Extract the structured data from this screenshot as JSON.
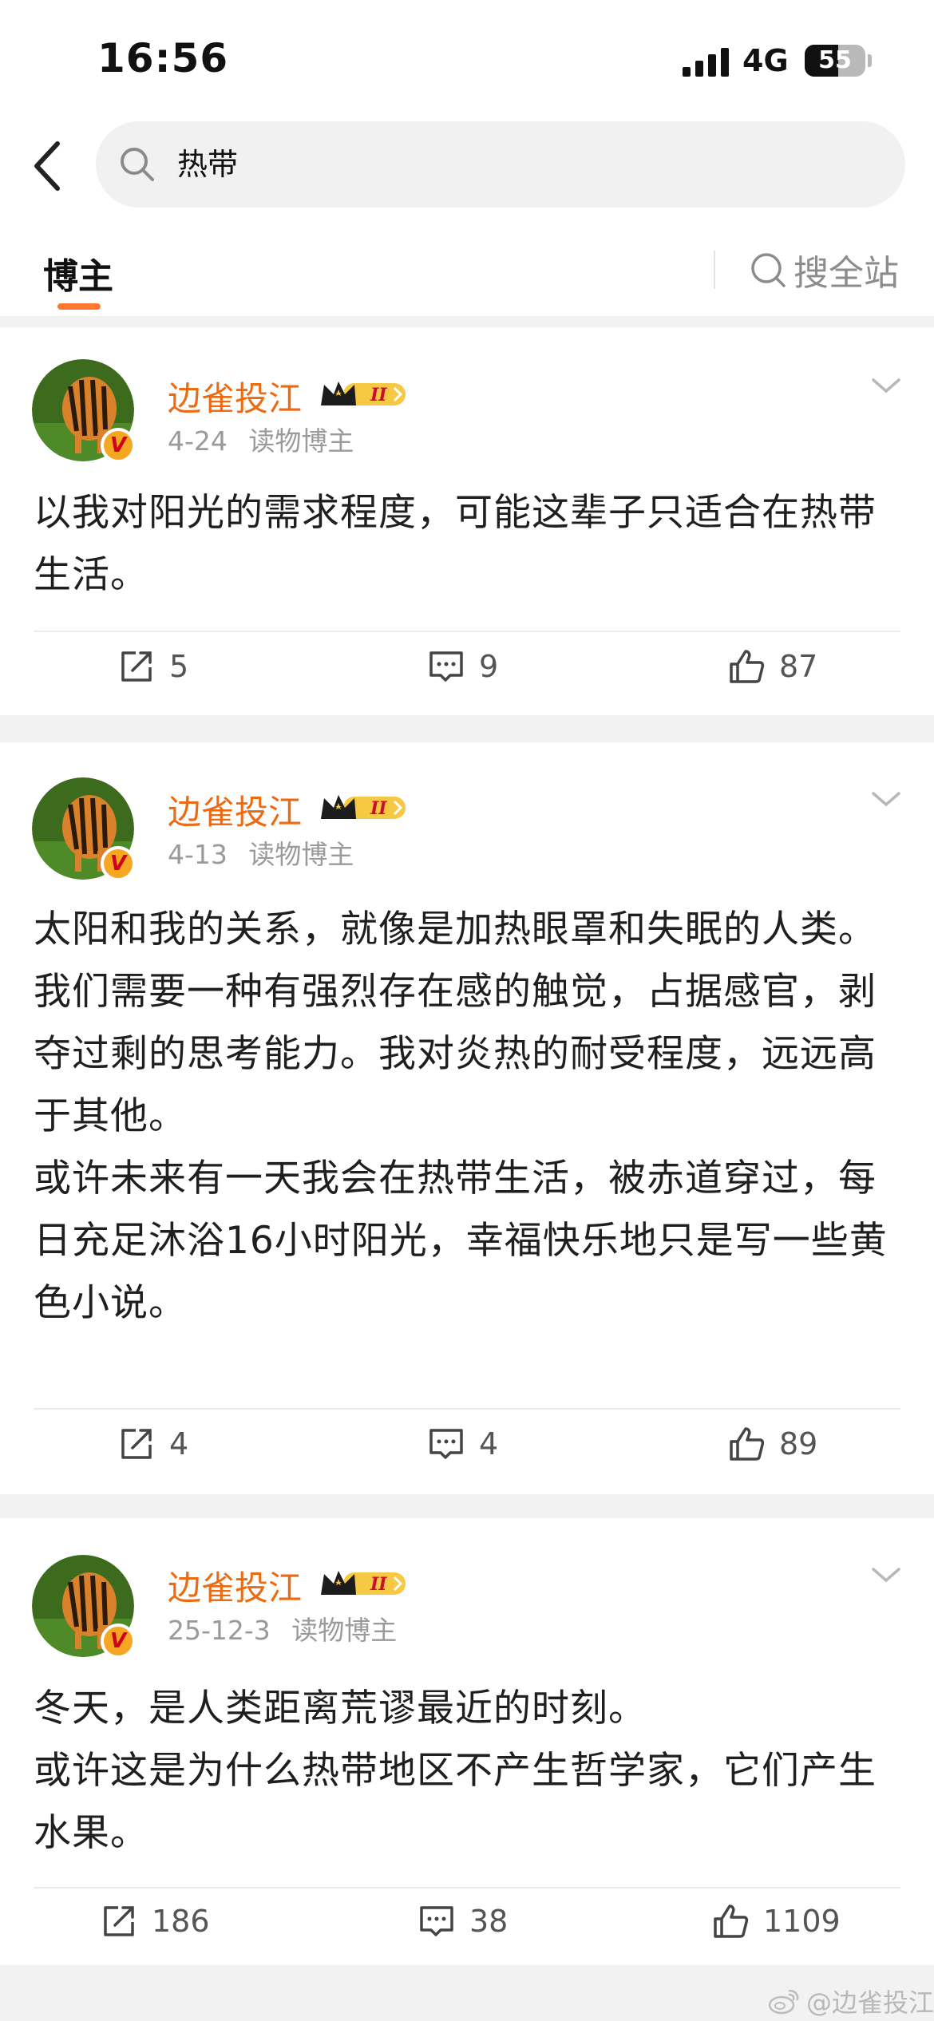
{
  "status_bar": {
    "time": "16:56",
    "network": "4G",
    "battery": "55",
    "battery_level": 0.55
  },
  "search": {
    "query": "热带"
  },
  "tabs": {
    "active": "博主",
    "search_all": "搜全站"
  },
  "posts": [
    {
      "author": "边雀投江",
      "date": "4-24",
      "tag": "读物博主",
      "text": "以我对阳光的需求程度，可能这辈子只适合在热带生活。",
      "reposts": "5",
      "comments": "9",
      "likes": "87"
    },
    {
      "author": "边雀投江",
      "date": "4-13",
      "tag": "读物博主",
      "text": "太阳和我的关系，就像是加热眼罩和失眠的人类。\n我们需要一种有强烈存在感的触觉，占据感官，剥夺过剩的思考能力。我对炎热的耐受程度，远远高于其他。\n或许未来有一天我会在热带生活，被赤道穿过，每日充足沐浴16小时阳光，幸福快乐地只是写一些黄色小说。",
      "reposts": "4",
      "comments": "4",
      "likes": "89"
    },
    {
      "author": "边雀投江",
      "date": "25-12-3",
      "tag": "读物博主",
      "text": "冬天，是人类距离荒谬最近的时刻。\n或许这是为什么热带地区不产生哲学家，它们产生水果。",
      "reposts": "186",
      "comments": "38",
      "likes": "1109"
    }
  ],
  "badges": {
    "vip_level": "II",
    "verified": "V"
  },
  "watermark": "@边雀投江",
  "colors": {
    "author": "#ec6a12",
    "accent": "#ff7a2f",
    "meta": "#9a9a9a"
  }
}
